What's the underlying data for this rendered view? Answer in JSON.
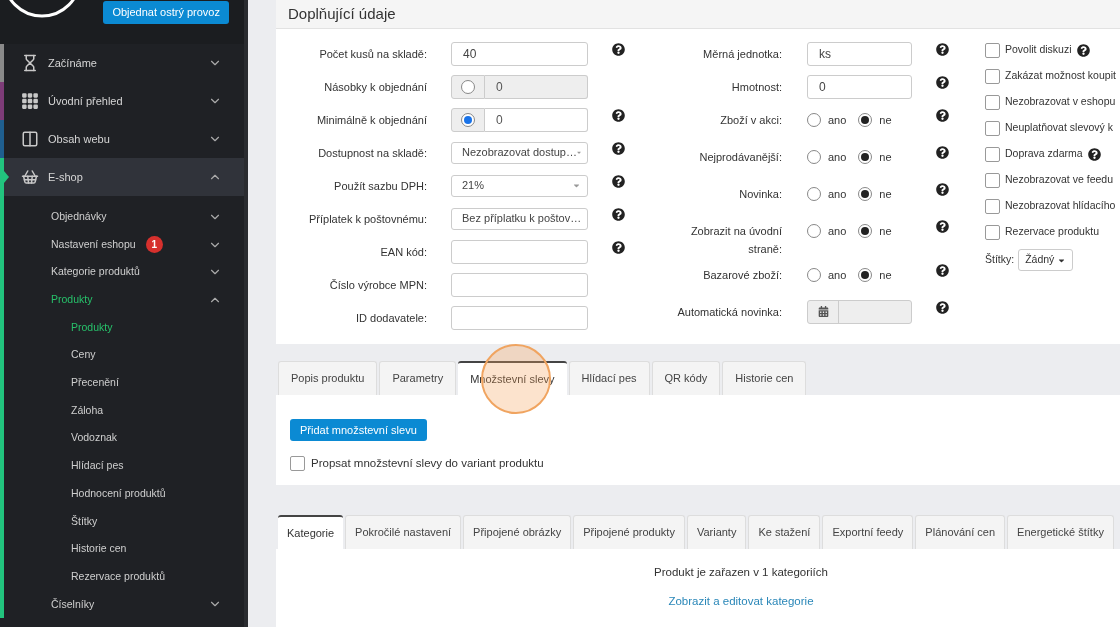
{
  "sidebar": {
    "order_button": "Objednat ostrý provoz",
    "menu": [
      {
        "label": "Začínáme",
        "kind": "hourglass",
        "color": "#8a8a8a",
        "expanded": false,
        "selected": false
      },
      {
        "label": "Úvodní přehled",
        "kind": "grid",
        "color": "#7d3c78",
        "expanded": false,
        "selected": false
      },
      {
        "label": "Obsah webu",
        "kind": "columns",
        "color": "#1f5f8f",
        "expanded": false,
        "selected": false
      },
      {
        "label": "E-shop",
        "kind": "basket",
        "color": "#22c47e",
        "expanded": true,
        "selected": true,
        "children": [
          {
            "label": "Objednávky",
            "expanded": false,
            "selected": false
          },
          {
            "label": "Nastavení eshopu",
            "badge": "1",
            "expanded": false,
            "selected": false
          },
          {
            "label": "Kategorie produktů",
            "expanded": false,
            "selected": false
          },
          {
            "label": "Produkty",
            "expanded": true,
            "selected": true,
            "children": [
              {
                "label": "Produkty",
                "selected": true
              },
              {
                "label": "Ceny",
                "selected": false
              },
              {
                "label": "Přecenění",
                "selected": false
              },
              {
                "label": "Záloha",
                "selected": false
              },
              {
                "label": "Vodoznak",
                "selected": false
              },
              {
                "label": "Hlídací pes",
                "selected": false
              },
              {
                "label": "Hodnocení produktů",
                "selected": false
              },
              {
                "label": "Štítky",
                "selected": false
              },
              {
                "label": "Historie cen",
                "selected": false
              },
              {
                "label": "Rezervace produktů",
                "selected": false
              }
            ]
          },
          {
            "label": "Číselníky",
            "expanded": false,
            "selected": false
          }
        ]
      }
    ]
  },
  "details": {
    "title": "Doplňující údaje",
    "left_fields": [
      {
        "kind": "text",
        "label": "Počet kusů na skladě:",
        "value": "40",
        "help": true
      },
      {
        "kind": "toggle_input",
        "label": "Násobky k objednání",
        "value": "0",
        "checked": false,
        "help": false
      },
      {
        "kind": "toggle_input",
        "label": "Minimálně k objednání",
        "value": "0",
        "checked": true,
        "help": true
      },
      {
        "kind": "select",
        "label": "Dostupnost na skladě:",
        "value": "Nezobrazovat dostup…",
        "help": true
      },
      {
        "kind": "select",
        "label": "Použít sazbu DPH:",
        "value": "21%",
        "help": true
      },
      {
        "kind": "select",
        "label": "Příplatek k poštovnému:",
        "value": "Bez příplatku k poštov…",
        "help": true
      },
      {
        "kind": "text",
        "label": "EAN kód:",
        "help": true
      },
      {
        "kind": "text",
        "label": "Číslo výrobce MPN:",
        "help": false
      },
      {
        "kind": "text",
        "label": "ID dodavatele:",
        "help": false
      }
    ],
    "middle_fields": [
      {
        "kind": "text",
        "label": "Měrná jednotka:",
        "value": "ks",
        "help": true
      },
      {
        "kind": "text",
        "label": "Hmotnost:",
        "value": "0",
        "help": true
      },
      {
        "kind": "yesno",
        "label": "Zboží v akci:",
        "help": true,
        "options": [
          {
            "label": "ano",
            "selected": false
          },
          {
            "label": "ne",
            "selected": true
          }
        ]
      },
      {
        "kind": "yesno",
        "label": "Nejprodávanější:",
        "help": true,
        "options": [
          {
            "label": "ano",
            "selected": false
          },
          {
            "label": "ne",
            "selected": true
          }
        ]
      },
      {
        "kind": "yesno",
        "label": "Novinka:",
        "help": true,
        "options": [
          {
            "label": "ano",
            "selected": false
          },
          {
            "label": "ne",
            "selected": true
          }
        ]
      },
      {
        "kind": "yesno",
        "label": "Zobrazit na úvodní straně:",
        "help": true,
        "options": [
          {
            "label": "ano",
            "selected": false
          },
          {
            "label": "ne",
            "selected": true
          }
        ]
      },
      {
        "kind": "yesno",
        "label": "Bazarové zboží:",
        "help": true,
        "options": [
          {
            "label": "ano",
            "selected": false
          },
          {
            "label": "ne",
            "selected": true
          }
        ]
      },
      {
        "kind": "date",
        "label": "Automatická novinka:",
        "help": true
      }
    ],
    "checkboxes": [
      {
        "label": "Povolit diskuzi",
        "checked": false,
        "help": true
      },
      {
        "label": "Zakázat možnost koupit",
        "checked": false,
        "help": false
      },
      {
        "label": "Nezobrazovat v eshopu",
        "checked": false,
        "help": false
      },
      {
        "label": "Neuplatňovat slevový k",
        "checked": false,
        "help": false
      },
      {
        "label": "Doprava zdarma",
        "checked": false,
        "help": true
      },
      {
        "label": "Nezobrazovat ve feedu",
        "checked": false,
        "help": false
      },
      {
        "label": "Nezobrazovat hlídacího",
        "checked": false,
        "help": false
      },
      {
        "label": "Rezervace produktu",
        "checked": false,
        "help": false
      }
    ],
    "tags": {
      "label": "Štítky:",
      "value": "Žádný"
    }
  },
  "tabs_top": {
    "tabs": [
      {
        "label": "Popis produktu",
        "selected": false
      },
      {
        "label": "Parametry",
        "selected": false
      },
      {
        "label": "Množstevní slevy",
        "selected": true
      },
      {
        "label": "Hlídací pes",
        "selected": false
      },
      {
        "label": "QR kódy",
        "selected": false
      },
      {
        "label": "Historie cen",
        "selected": false
      }
    ],
    "button": "Přidat množstevní slevu",
    "checkbox": {
      "label": "Propsat množstevní slevy do variant produktu",
      "checked": false
    }
  },
  "tabs_bottom": {
    "tabs": [
      {
        "label": "Kategorie",
        "selected": true
      },
      {
        "label": "Pokročilé nastavení",
        "selected": false
      },
      {
        "label": "Připojené obrázky",
        "selected": false
      },
      {
        "label": "Připojené produkty",
        "selected": false
      },
      {
        "label": "Varianty",
        "selected": false
      },
      {
        "label": "Ke stažení",
        "selected": false
      },
      {
        "label": "Exportní feedy",
        "selected": false
      },
      {
        "label": "Plánování cen",
        "selected": false
      },
      {
        "label": "Energetické štítky",
        "selected": false
      }
    ],
    "message": "Produkt je zařazen v 1 kategoriích",
    "link": "Zobrazit a editovat kategorie"
  }
}
